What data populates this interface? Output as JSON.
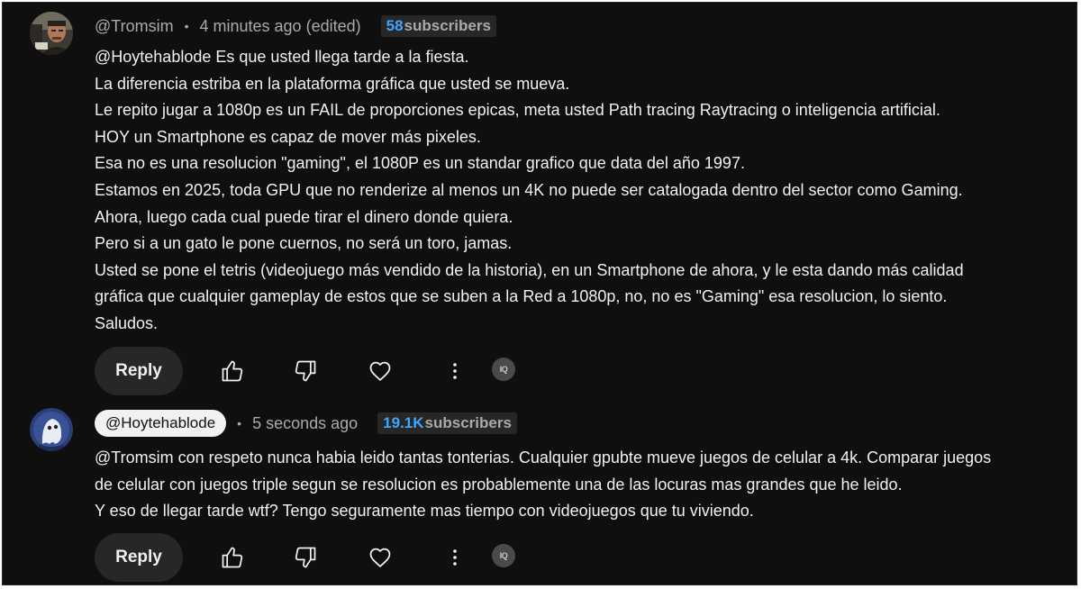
{
  "comments": [
    {
      "author": "@Tromsim",
      "time": "4 minutes ago (edited)",
      "subscribers_count": "58",
      "subscribers_label": "subscribers",
      "lines": [
        "@Hoytehablode  Es que usted llega tarde a la fiesta.",
        "La diferencia estriba en la plataforma gráfica que usted se mueva.",
        "Le repito jugar a 1080p es un FAIL de proporciones epicas, meta usted Path tracing Raytracing o inteligencia artificial.",
        "HOY un Smartphone es capaz de mover más pixeles.",
        "Esa no es una resolucion \"gaming\", el 1080P es un standar grafico que data del año 1997.",
        "Estamos en 2025, toda GPU que no renderize al menos un 4K no puede ser catalogada dentro del sector como Gaming.",
        "Ahora, luego cada cual puede tirar el dinero donde quiera.",
        "Pero si a un gato le pone cuernos, no será un toro, jamas.",
        "Usted se pone el tetris (videojuego más vendido de la historia), en un Smartphone de ahora, y le esta dando más calidad",
        "gráfica que cualquier gameplay de estos que se suben a la Red a 1080p, no, no es \"Gaming\" esa resolucion, lo siento.",
        "Saludos."
      ],
      "reply_label": "Reply",
      "badge_text": "IQ"
    },
    {
      "author": "@Hoytehablode",
      "time": "5 seconds ago",
      "subscribers_count": "19.1K",
      "subscribers_label": "subscribers",
      "lines": [
        "@Tromsim con respeto nunca habia leido tantas tonterias. Cualquier gpubte mueve juegos de celular a 4k. Comparar juegos",
        "de celular con juegos triple segun se resolucion es probablemente una de las locuras mas grandes que he leido.",
        "Y eso de llegar tarde wtf? Tengo seguramente mas tiempo con videojuegos que tu viviendo."
      ],
      "reply_label": "Reply",
      "badge_text": "IQ"
    }
  ],
  "separator": "•",
  "icons": {
    "like": "thumbs-up-icon",
    "dislike": "thumbs-down-icon",
    "heart": "heart-icon",
    "more": "more-vertical-icon"
  },
  "colors": {
    "background": "#0f0f0f",
    "text": "#f1f1f1",
    "muted": "#aaaaaa",
    "subscriber_count": "#3ea6ff",
    "button": "#272727"
  }
}
